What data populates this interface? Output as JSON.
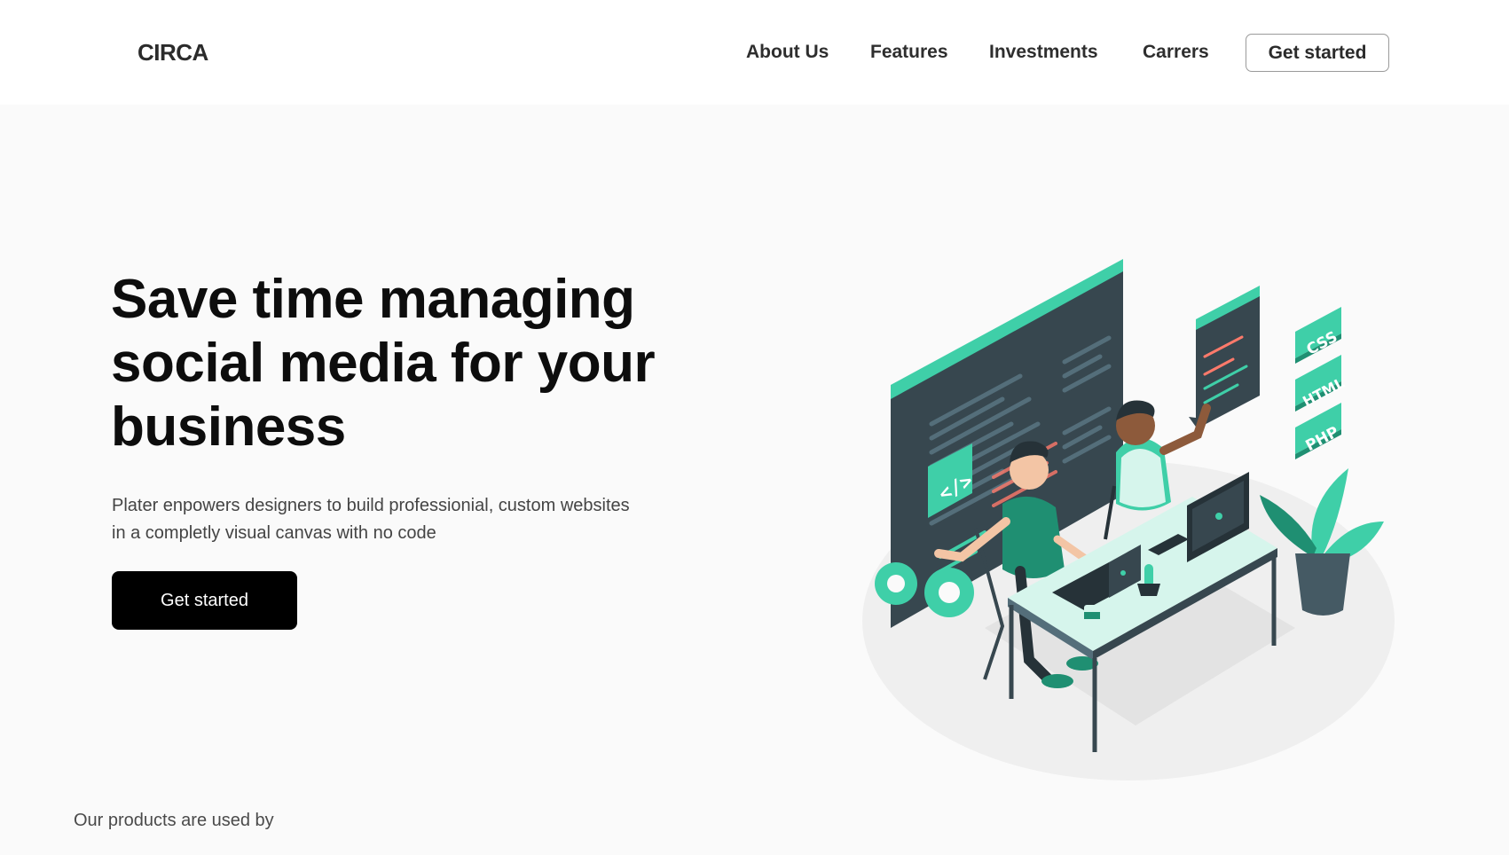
{
  "brand": {
    "name": "CIRCA"
  },
  "nav": {
    "items": [
      {
        "label": "About Us"
      },
      {
        "label": "Features"
      },
      {
        "label": "Investments"
      },
      {
        "label": "Carrers"
      }
    ],
    "cta_label": "Get started"
  },
  "hero": {
    "title": "Save time managing social media for your business",
    "description": "Plater enpowers designers to build professionial, custom websites in a completly visual canvas with no code",
    "cta_label": "Get started",
    "illustration": {
      "icon": "developers-at-desk-illustration",
      "code_tags": [
        "CSS",
        "HTML",
        "PHP"
      ],
      "code_symbol": "</>"
    }
  },
  "customers": {
    "label": "Our products are used by"
  },
  "colors": {
    "accent": "#3fcfa8",
    "accent_dark": "#1f8f72",
    "dark_screen": "#37474f",
    "button_bg": "#000000",
    "hero_bg": "#fafafa"
  }
}
